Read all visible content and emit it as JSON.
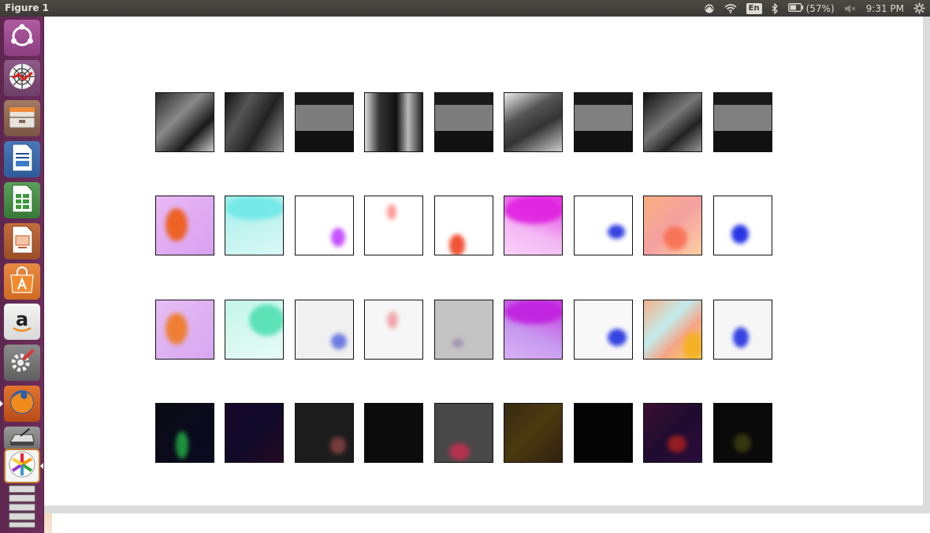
{
  "top_panel": {
    "window_title": "Figure 1",
    "keyboard_layout": "En",
    "battery_percent": "(57%)",
    "clock": "9:31 PM"
  },
  "launcher": {
    "items": [
      {
        "name": "dash-home-icon"
      },
      {
        "name": "network-web-icon"
      },
      {
        "name": "files-icon"
      },
      {
        "name": "writer-icon"
      },
      {
        "name": "calc-icon"
      },
      {
        "name": "impress-icon"
      },
      {
        "name": "software-center-icon"
      },
      {
        "name": "amazon-icon"
      },
      {
        "name": "system-settings-icon"
      },
      {
        "name": "firefox-icon"
      },
      {
        "name": "scanner-icon"
      },
      {
        "name": "image-viewer-icon"
      },
      {
        "name": "workspace-stack-icon"
      }
    ]
  },
  "figure": {
    "rows": 4,
    "columns": 9,
    "row_types": [
      "grayscale-frame",
      "optical-flow",
      "optical-flow-estimate",
      "flow-error"
    ]
  }
}
